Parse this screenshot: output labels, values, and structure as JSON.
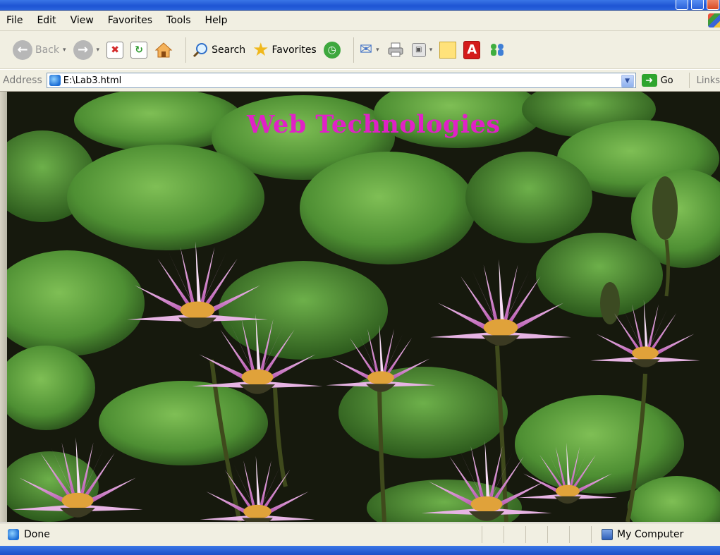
{
  "menu": [
    "File",
    "Edit",
    "View",
    "Favorites",
    "Tools",
    "Help"
  ],
  "toolbar": {
    "back_label": "Back",
    "search_label": "Search",
    "favorites_label": "Favorites"
  },
  "address": {
    "label": "Address",
    "url": "E:\\Lab3.html",
    "go_label": "Go",
    "links_label": "Links"
  },
  "page": {
    "heading": "Web Technologies",
    "heading_color": "#e021c6"
  },
  "status": {
    "text": "Done",
    "zone": "My Computer"
  },
  "colors": {
    "chrome": "#f1efe2",
    "titlebar": "#2a63dc"
  }
}
